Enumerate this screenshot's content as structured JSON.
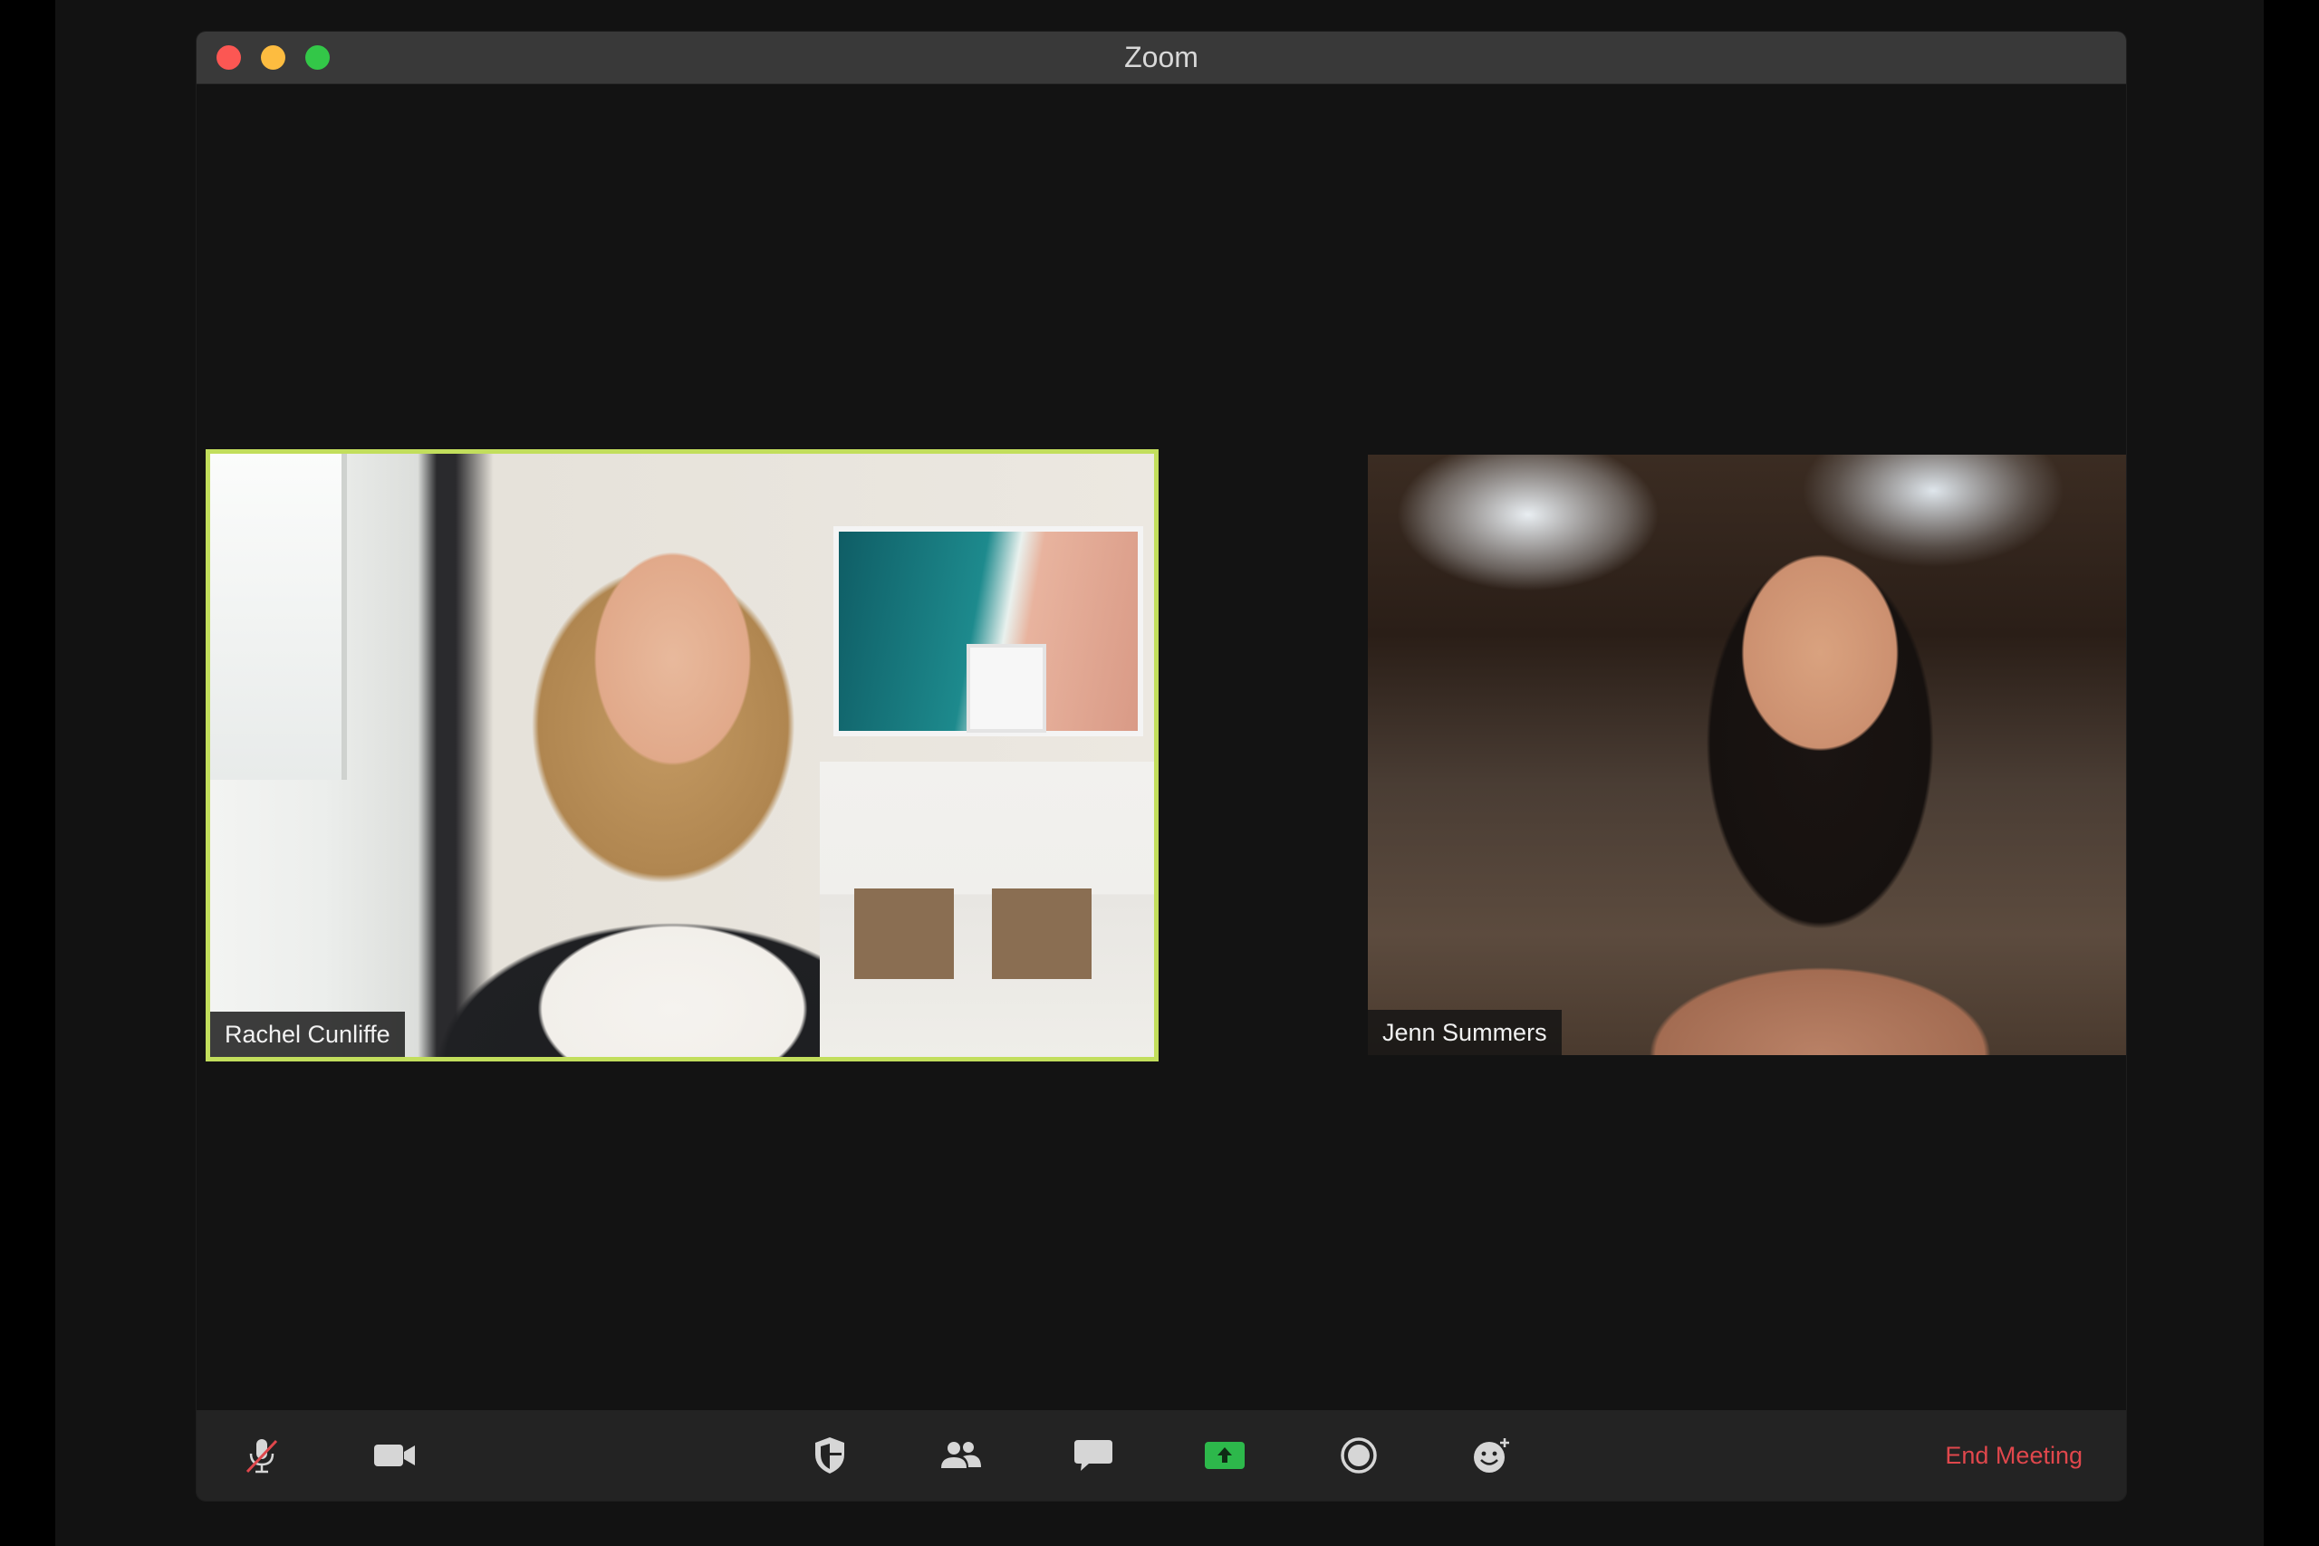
{
  "window": {
    "title": "Zoom"
  },
  "participants": [
    {
      "name": "Rachel Cunliffe",
      "active_speaker": true
    },
    {
      "name": "Jenn Summers",
      "active_speaker": false
    }
  ],
  "toolbar": {
    "icons": [
      "mic-muted-icon",
      "video-icon",
      "shield-icon",
      "participants-icon",
      "chat-icon",
      "share-screen-icon",
      "record-icon",
      "reactions-icon"
    ],
    "end_label": "End Meeting"
  },
  "colors": {
    "active_speaker_border": "#c2de5c",
    "share_green": "#2db84b",
    "end_red": "#e0474c",
    "close": "#fc5753",
    "minimize": "#fdbc40",
    "maximize": "#33c748"
  }
}
